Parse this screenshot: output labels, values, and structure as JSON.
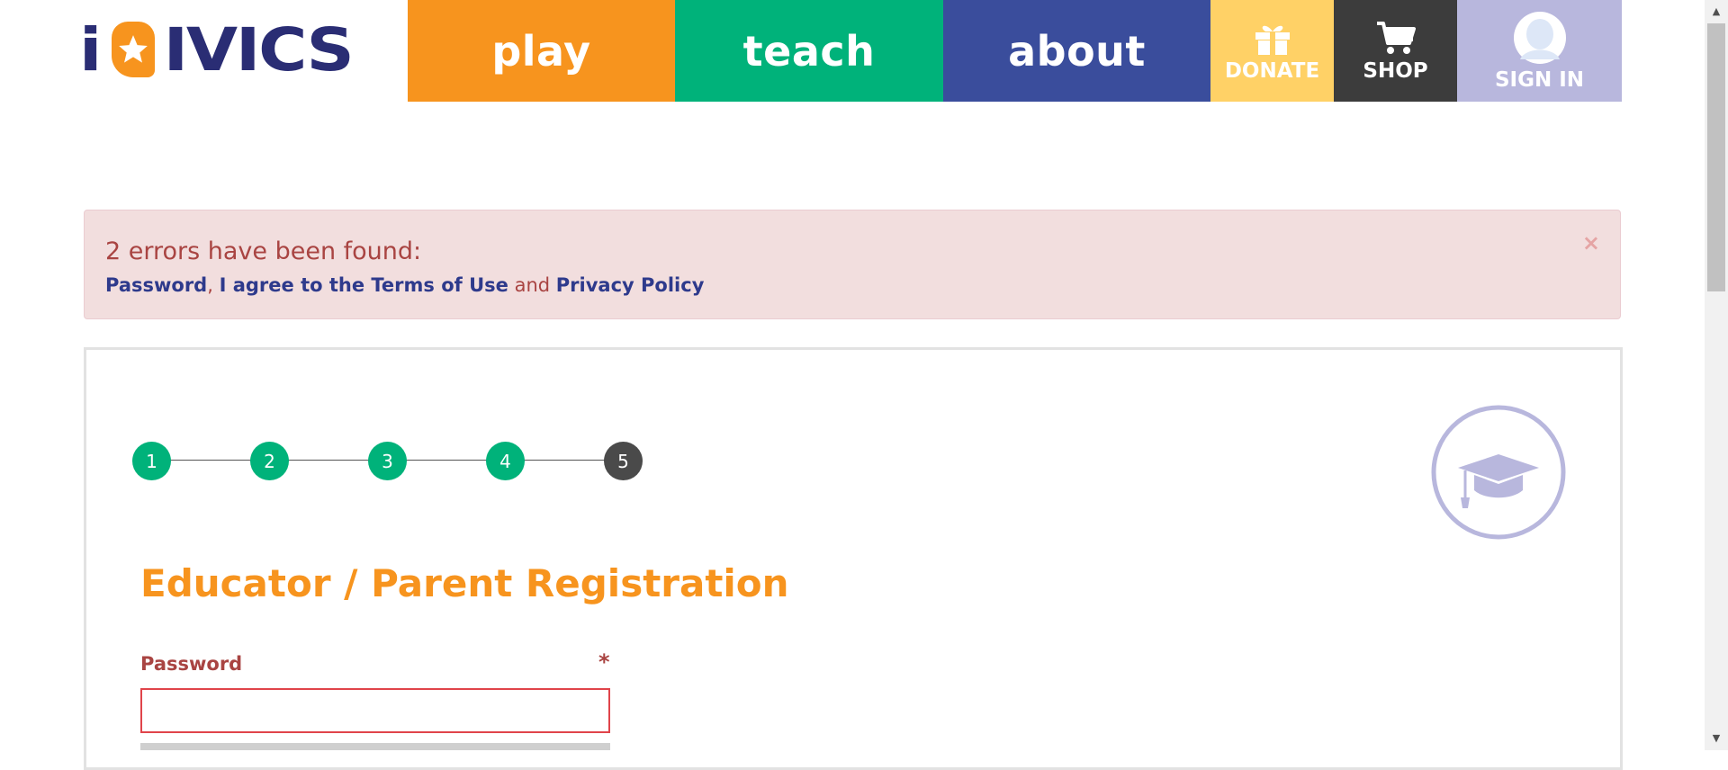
{
  "brand": {
    "logo_text": "iCivics"
  },
  "nav": {
    "play": "play",
    "teach": "teach",
    "about": "about",
    "donate": "DONATE",
    "shop": "SHOP",
    "sign_in": "SIGN IN"
  },
  "alert": {
    "title": "2 errors have been found:",
    "links": [
      "Password",
      "I agree to the Terms of Use",
      "Privacy Policy"
    ],
    "separator_comma": ",",
    "separator_and": "and",
    "close_symbol": "×"
  },
  "steps": {
    "items": [
      "1",
      "2",
      "3",
      "4",
      "5"
    ],
    "current": 5
  },
  "form": {
    "title": "Educator / Parent Registration",
    "password_label": "Password",
    "required_marker": "*",
    "password_value": ""
  },
  "colors": {
    "play": "#f7941e",
    "teach": "#00b27a",
    "about": "#3a4d9c",
    "donate": "#ffd166",
    "shop": "#3c3c3c",
    "sign_in": "#b8b7dd",
    "error_text": "#a94442",
    "link": "#2e3a8c"
  },
  "icons": [
    "star-icon",
    "gift-icon",
    "cart-icon",
    "user-avatar-icon",
    "graduation-cap-icon",
    "close-icon"
  ]
}
